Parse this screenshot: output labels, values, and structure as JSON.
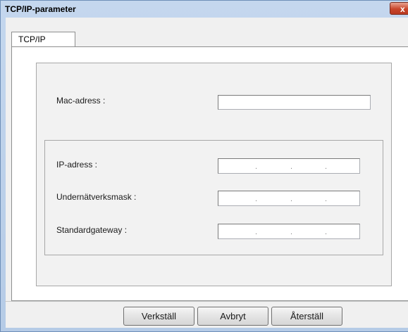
{
  "window": {
    "title": "TCP/IP-parameter",
    "close_glyph": "x"
  },
  "tabs": [
    {
      "label": "TCP/IP",
      "active": true
    }
  ],
  "fields": {
    "mac": {
      "label": "Mac-adress :",
      "value": ""
    },
    "ip": {
      "label": "IP-adress :",
      "value": ""
    },
    "subnet": {
      "label": "Undernätverksmask :",
      "value": ""
    },
    "gateway": {
      "label": "Standardgateway :",
      "value": ""
    }
  },
  "ip_separator": ".",
  "buttons": {
    "apply": "Verkställ",
    "cancel": "Avbryt",
    "reset": "Återställ"
  }
}
